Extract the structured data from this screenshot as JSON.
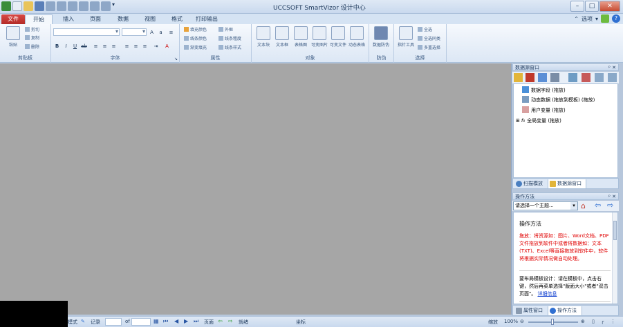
{
  "window": {
    "title": "UCCSOFT SmartVizor 设计中心"
  },
  "tabs": [
    {
      "label": "文件"
    },
    {
      "label": "开始"
    },
    {
      "label": "插入"
    },
    {
      "label": "页面"
    },
    {
      "label": "数据"
    },
    {
      "label": "视图"
    },
    {
      "label": "格式"
    },
    {
      "label": "打印输出"
    }
  ],
  "tabbar_right": {
    "options_label": "选项"
  },
  "ribbon": {
    "clipboard": {
      "paste": "粘贴",
      "cut": "剪切",
      "copy": "复制",
      "delete": "删除",
      "label": "剪贴板"
    },
    "font": {
      "label": "字体"
    },
    "properties": {
      "fill_color": "填充颜色",
      "line_color": "线条颜色",
      "gradient_fill": "渐变填充",
      "shape": "外框",
      "line_thickness": "线条粗度",
      "line_style": "线条样式",
      "label": "属性"
    },
    "objects": {
      "items": [
        "文本块",
        "文本框",
        "表格图",
        "可变图片",
        "可变文件",
        "动态表格"
      ],
      "label": "对象"
    },
    "security": {
      "items": [
        "数据防伪"
      ],
      "label": "防伪"
    },
    "select": {
      "tool": "指针工具",
      "select_all": "全选",
      "select_similar": "全选同类",
      "multi_select": "多重选择",
      "label": "选择"
    }
  },
  "datasource_panel": {
    "title": "数据源窗口",
    "tree": [
      {
        "label": "数据字段 (拖放)"
      },
      {
        "label": "动态数据 (拖放到模板) (拖放)"
      },
      {
        "label": "用户变量 (拖放)"
      },
      {
        "label": "全局变量 (拖放)"
      }
    ],
    "tabs": [
      "扫描模放",
      "数据源窗口"
    ]
  },
  "howto_panel": {
    "title": "操作方法",
    "select_placeholder": "请选择一个主题...",
    "heading": "操作方法",
    "red_text": "拖放：将资源如：图片、Word文档、PDF文件拖放到软件中或者将数据如：文本(TXT)、Excel等直接拖放到软件中，软件将根据实际情况做自动处理。",
    "layout_text": "要布局模板设计：请在模板中，点击右键，然后再菜单选择\"版面大小\"或者\"双击页面\"。",
    "detail_link": "详细信息",
    "tabs": [
      "属性窗口",
      "操作方法"
    ]
  },
  "statusbar": {
    "mode": "模式",
    "record": "记录",
    "of": "of",
    "page": "页面",
    "ready": "就绪",
    "coords": "坐标",
    "zoom_label": "缩放",
    "zoom_value": "100%"
  },
  "colors": {
    "file_tab": "#c0312c",
    "canvas": "#a6a6a6",
    "ribbon": "#dce7f5",
    "red_text": "#e00000",
    "link": "#0033cc"
  }
}
